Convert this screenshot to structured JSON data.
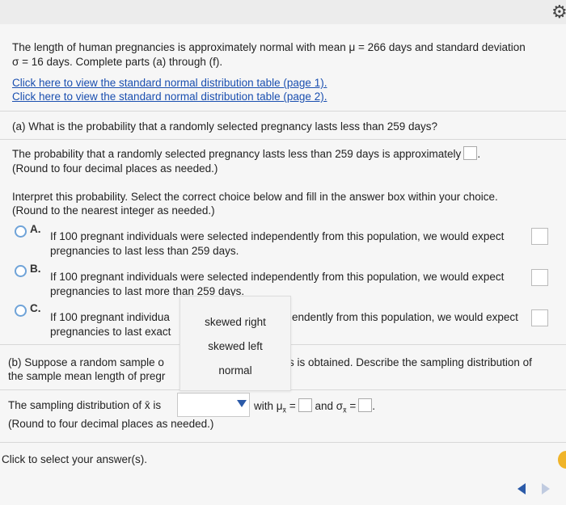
{
  "intro": {
    "line1": "The length of human pregnancies is approximately normal with mean μ = 266 days and standard deviation",
    "line2": "σ = 16 days. Complete parts (a) through (f)."
  },
  "links": [
    "Click here to view the standard normal distribution table (page 1).",
    "Click here to view the standard normal distribution table (page 2)."
  ],
  "part_a": {
    "question": "(a) What is the probability that a randomly selected pregnancy lasts less than 259 days?",
    "answer_line": "The probability that a randomly selected pregnancy lasts less than 259 days is approximately",
    "round_note": "(Round to four decimal places as needed.)",
    "interpret_line1": "Interpret this probability. Select the correct choice below and fill in the answer box within your choice.",
    "interpret_line2": "(Round to the nearest integer as needed.)",
    "choices": [
      {
        "letter": "A.",
        "line1": "If 100 pregnant individuals were selected independently from this population, we would expect",
        "line2": "pregnancies to last less than 259 days."
      },
      {
        "letter": "B.",
        "line1": "If 100 pregnant individuals were selected independently from this population, we would expect",
        "line2": "pregnancies to last more than 259 days."
      },
      {
        "letter": "C.",
        "line1a": "If 100 pregnant individua",
        "line1b": "endently from this population, we would expect",
        "line2": "pregnancies to last exact"
      }
    ]
  },
  "part_b": {
    "line1a": "(b) Suppose a random sample o",
    "line1b": "s is obtained. Describe the sampling distribution of",
    "line2": "the sample mean length of pregr"
  },
  "dropdown": {
    "options": [
      "skewed right",
      "skewed left",
      "normal"
    ]
  },
  "sampling": {
    "prefix": "The sampling distribution of x̄ is",
    "with": "with μ",
    "sub": "x̄",
    "eq": "=",
    "and": "and σ",
    "round_note": "(Round to four decimal places as needed.)"
  },
  "footer": {
    "prompt": "Click to select your answer(s)."
  }
}
